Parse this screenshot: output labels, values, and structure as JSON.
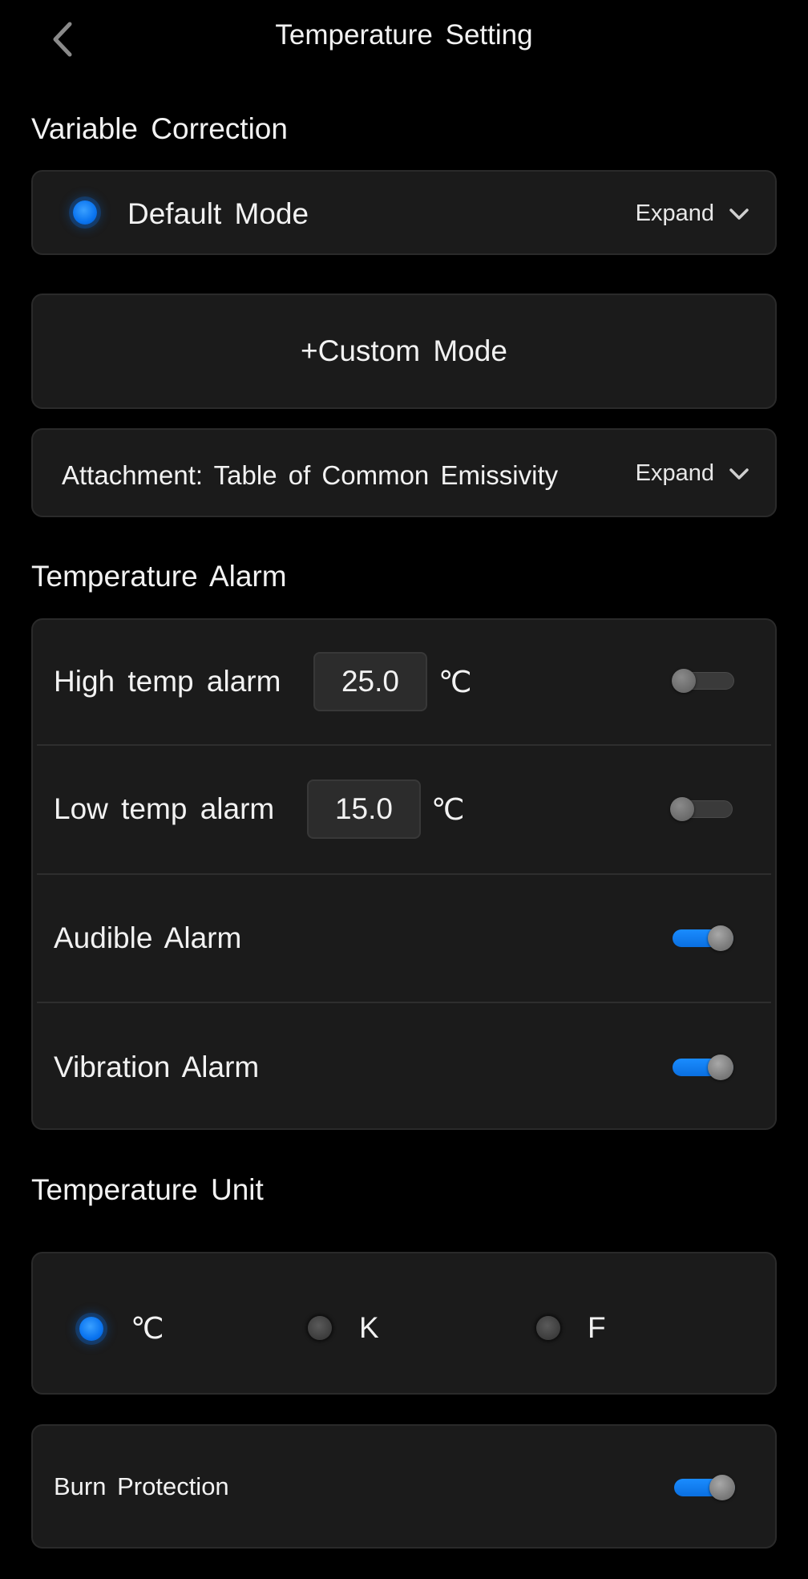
{
  "header": {
    "title": "Temperature Setting"
  },
  "variable_correction": {
    "title": "Variable Correction",
    "default_mode_label": "Default Mode",
    "default_mode_selected": true,
    "expand_label": "Expand",
    "custom_mode_label": "+Custom Mode",
    "attachment_label": "Attachment: Table of Common Emissivity",
    "attachment_expand_label": "Expand"
  },
  "temperature_alarm": {
    "title": "Temperature Alarm",
    "high": {
      "label": "High temp alarm",
      "value": "25.0",
      "unit": "℃",
      "enabled": false
    },
    "low": {
      "label": "Low temp alarm",
      "value": "15.0",
      "unit": "℃",
      "enabled": false
    },
    "audible": {
      "label": "Audible Alarm",
      "enabled": true
    },
    "vibration": {
      "label": "Vibration Alarm",
      "enabled": true
    }
  },
  "temperature_unit": {
    "title": "Temperature Unit",
    "options": [
      {
        "label": "℃",
        "selected": true
      },
      {
        "label": "K",
        "selected": false
      },
      {
        "label": "F",
        "selected": false
      }
    ]
  },
  "burn_protection": {
    "label": "Burn Protection",
    "enabled": true
  },
  "colors": {
    "accent": "#0a74f0",
    "card": "#1b1b1b",
    "background": "#000000"
  }
}
